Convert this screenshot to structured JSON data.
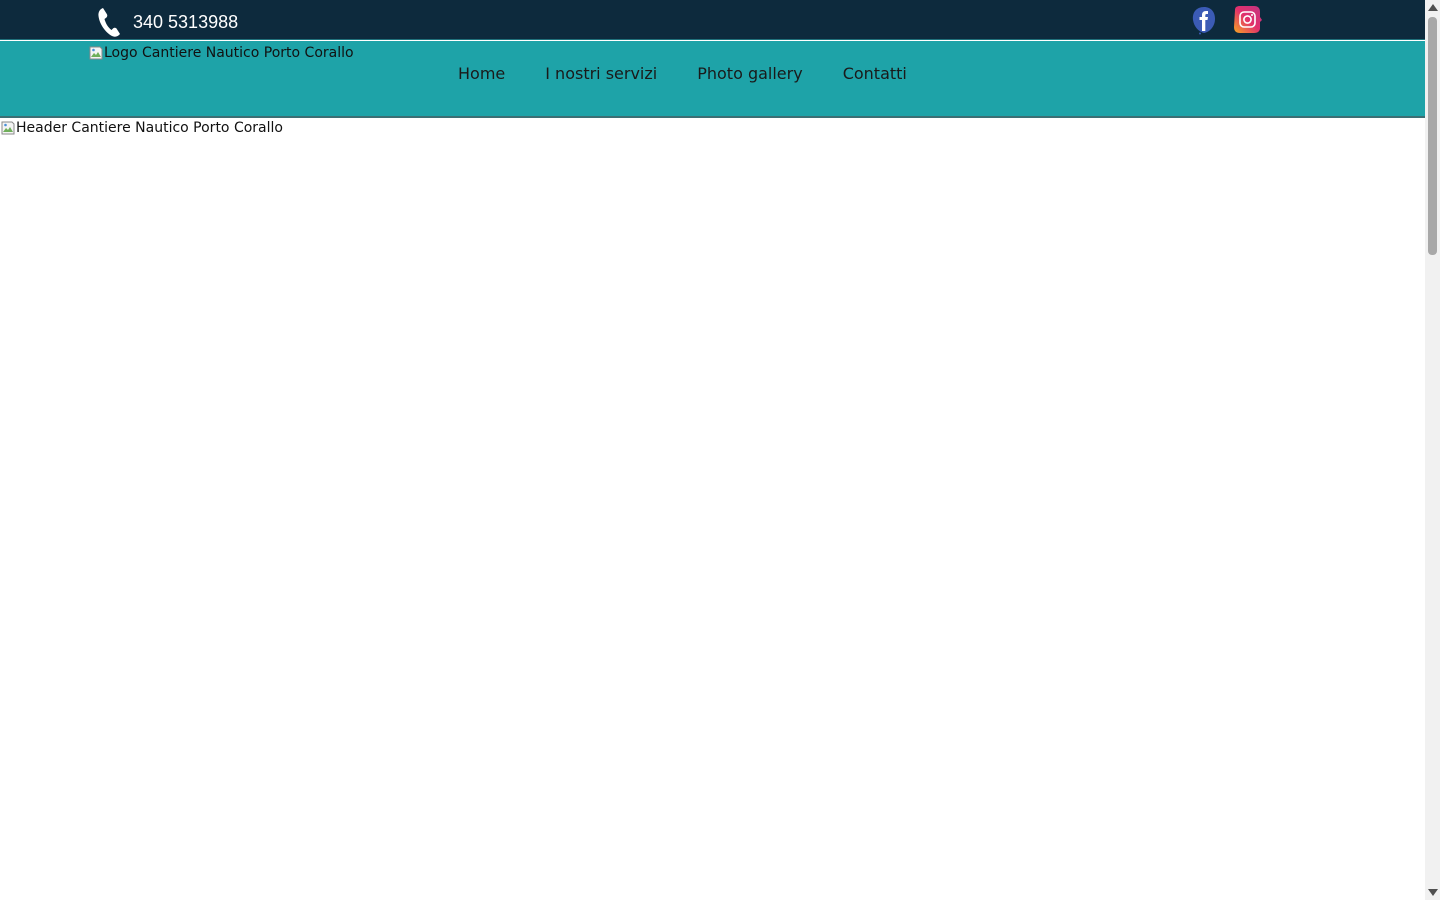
{
  "topbar": {
    "phone_icon": "phone-icon",
    "phone_number": "340 5313988",
    "socials": [
      {
        "name": "facebook",
        "icon": "facebook-icon"
      },
      {
        "name": "instagram",
        "icon": "instagram-icon"
      }
    ]
  },
  "navbar": {
    "logo_alt": "Logo Cantiere Nautico Porto Corallo",
    "items": [
      {
        "label": "Home"
      },
      {
        "label": "I nostri servizi"
      },
      {
        "label": "Photo gallery"
      },
      {
        "label": "Contatti"
      }
    ]
  },
  "header": {
    "image_alt": "Header Cantiere Nautico Porto Corallo"
  },
  "colors": {
    "topbar_bg": "#0d2a3d",
    "navbar_bg": "#1ea3a8",
    "page_bg": "#ffffff"
  }
}
